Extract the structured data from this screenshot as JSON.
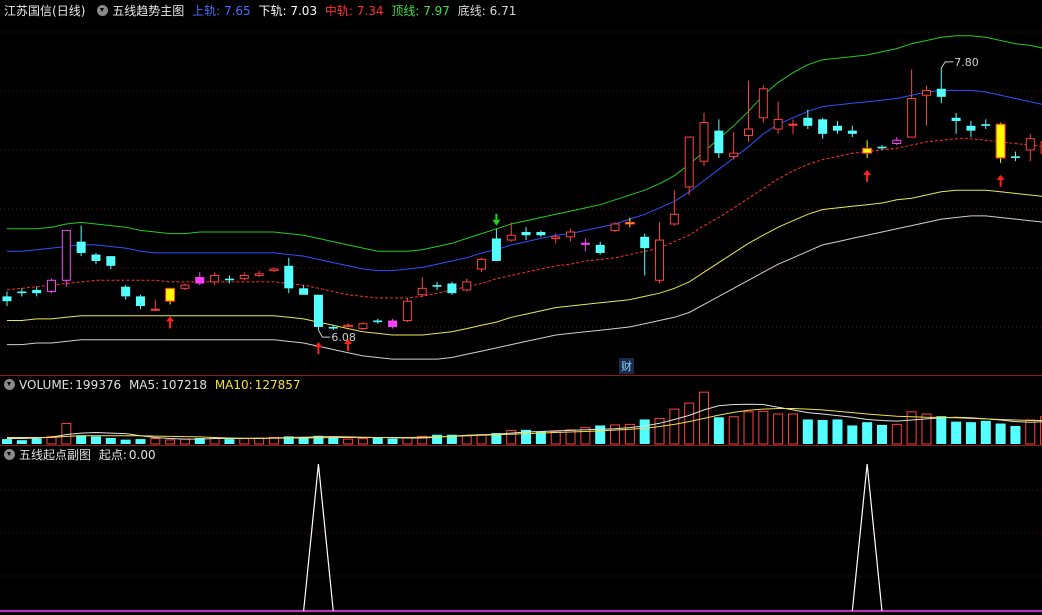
{
  "main": {
    "stock_name": "江苏国信",
    "period": "(日线)",
    "indicator": "五线趋势主图",
    "values": [
      {
        "label": "上轨:",
        "value": "7.65",
        "color": "#4a6dff"
      },
      {
        "label": "下轨:",
        "value": "7.03",
        "color": "#ffffff"
      },
      {
        "label": "中轨:",
        "value": "7.34",
        "color": "#ff3030"
      },
      {
        "label": "顶线:",
        "value": "7.97",
        "color": "#40e040"
      },
      {
        "label": "底线:",
        "value": "6.71",
        "color": "#d8d8d8"
      }
    ],
    "low_label": "6.08",
    "high_label": "7.80",
    "cai_label": "财"
  },
  "volume": {
    "label": "VOLUME:",
    "value": "199376",
    "ma5_label": "MA5:",
    "ma5_value": "107218",
    "ma10_label": "MA10:",
    "ma10_value": "127857"
  },
  "sub": {
    "indicator": "五线起点副图",
    "label": "起点:",
    "value": "0.00"
  },
  "chart_data": {
    "type": "candlestick",
    "candles": [
      [
        6.52,
        6.49,
        6.55,
        6.46
      ],
      [
        6.55,
        6.54,
        6.57,
        6.52
      ],
      [
        6.56,
        6.54,
        6.58,
        6.52
      ],
      [
        6.55,
        6.62,
        6.63,
        6.54
      ],
      [
        6.62,
        6.93,
        6.93,
        6.58
      ],
      [
        6.86,
        6.79,
        6.96,
        6.77
      ],
      [
        6.78,
        6.74,
        6.79,
        6.72
      ],
      [
        6.77,
        6.71,
        6.77,
        6.69
      ],
      [
        6.58,
        6.52,
        6.59,
        6.5
      ],
      [
        6.52,
        6.46,
        6.53,
        6.44
      ],
      [
        6.44,
        6.44,
        6.5,
        6.43
      ],
      [
        6.49,
        6.57,
        6.57,
        6.47
      ],
      [
        6.57,
        6.59,
        6.6,
        6.56
      ],
      [
        6.64,
        6.6,
        6.67,
        6.59
      ],
      [
        6.61,
        6.65,
        6.67,
        6.59
      ],
      [
        6.63,
        6.62,
        6.65,
        6.6
      ],
      [
        6.63,
        6.65,
        6.67,
        6.62
      ],
      [
        6.65,
        6.66,
        6.68,
        6.64
      ],
      [
        6.68,
        6.69,
        6.7,
        6.67
      ],
      [
        6.71,
        6.57,
        6.76,
        6.54
      ],
      [
        6.57,
        6.53,
        6.59,
        6.53
      ],
      [
        6.53,
        6.33,
        6.53,
        6.31
      ],
      [
        6.33,
        6.32,
        6.34,
        6.31
      ],
      [
        6.34,
        6.34,
        6.35,
        6.33
      ],
      [
        6.32,
        6.35,
        6.36,
        6.31
      ],
      [
        6.37,
        6.36,
        6.38,
        6.35
      ],
      [
        6.37,
        6.33,
        6.38,
        6.32
      ],
      [
        6.37,
        6.49,
        6.51,
        6.36
      ],
      [
        6.53,
        6.57,
        6.64,
        6.52
      ],
      [
        6.59,
        6.58,
        6.61,
        6.56
      ],
      [
        6.6,
        6.54,
        6.61,
        6.53
      ],
      [
        6.56,
        6.61,
        6.63,
        6.55
      ],
      [
        6.69,
        6.75,
        6.76,
        6.67
      ],
      [
        6.88,
        6.74,
        6.94,
        6.74
      ],
      [
        6.87,
        6.9,
        6.98,
        6.86
      ],
      [
        6.92,
        6.9,
        6.95,
        6.87
      ],
      [
        6.92,
        6.9,
        6.93,
        6.89
      ],
      [
        6.88,
        6.89,
        6.91,
        6.85
      ],
      [
        6.89,
        6.92,
        6.94,
        6.86
      ],
      [
        6.85,
        6.85,
        6.88,
        6.8
      ],
      [
        6.84,
        6.79,
        6.86,
        6.78
      ],
      [
        6.93,
        6.97,
        6.98,
        6.92
      ],
      [
        6.97,
        6.98,
        7.01,
        6.95
      ],
      [
        6.89,
        6.82,
        6.91,
        6.65
      ],
      [
        6.62,
        6.87,
        6.98,
        6.6
      ],
      [
        6.97,
        7.03,
        7.18,
        6.96
      ],
      [
        7.2,
        7.51,
        7.51,
        7.15
      ],
      [
        7.36,
        7.6,
        7.66,
        7.33
      ],
      [
        7.55,
        7.41,
        7.62,
        7.38
      ],
      [
        7.39,
        7.41,
        7.54,
        7.37
      ],
      [
        7.52,
        7.56,
        7.86,
        7.48
      ],
      [
        7.63,
        7.81,
        7.83,
        7.6
      ],
      [
        7.56,
        7.62,
        7.73,
        7.53
      ],
      [
        7.59,
        7.59,
        7.62,
        7.53
      ],
      [
        7.63,
        7.58,
        7.68,
        7.56
      ],
      [
        7.62,
        7.53,
        7.63,
        7.5
      ],
      [
        7.58,
        7.55,
        7.61,
        7.53
      ],
      [
        7.55,
        7.53,
        7.58,
        7.51
      ],
      [
        7.44,
        7.41,
        7.49,
        7.38
      ],
      [
        7.45,
        7.44,
        7.46,
        7.43
      ],
      [
        7.47,
        7.49,
        7.51,
        7.46
      ],
      [
        7.51,
        7.75,
        7.93,
        7.51
      ],
      [
        7.77,
        7.8,
        7.83,
        7.58
      ],
      [
        7.81,
        7.76,
        7.94,
        7.72
      ],
      [
        7.63,
        7.61,
        7.66,
        7.53
      ],
      [
        7.58,
        7.55,
        7.61,
        7.51
      ],
      [
        7.59,
        7.58,
        7.62,
        7.56
      ],
      [
        7.59,
        7.38,
        7.6,
        7.35
      ],
      [
        7.39,
        7.38,
        7.42,
        7.36
      ],
      [
        7.43,
        7.5,
        7.53,
        7.36
      ],
      [
        7.41,
        7.48,
        7.56,
        7.4
      ]
    ],
    "bands": {
      "top": [
        6.94,
        6.94,
        6.94,
        6.95,
        6.97,
        6.98,
        6.97,
        6.96,
        6.95,
        6.93,
        6.92,
        6.91,
        6.91,
        6.92,
        6.92,
        6.92,
        6.92,
        6.92,
        6.92,
        6.91,
        6.9,
        6.88,
        6.86,
        6.84,
        6.82,
        6.8,
        6.8,
        6.8,
        6.81,
        6.83,
        6.85,
        6.88,
        6.91,
        6.94,
        6.97,
        6.99,
        7.01,
        7.03,
        7.05,
        7.07,
        7.09,
        7.12,
        7.15,
        7.18,
        7.22,
        7.27,
        7.34,
        7.42,
        7.5,
        7.58,
        7.67,
        7.77,
        7.85,
        7.91,
        7.96,
        7.99,
        8.0,
        8.01,
        8.02,
        8.04,
        8.06,
        8.09,
        8.11,
        8.13,
        8.14,
        8.14,
        8.13,
        8.11,
        8.09,
        8.08,
        8.06
      ],
      "upper": [
        6.8,
        6.8,
        6.81,
        6.82,
        6.83,
        6.84,
        6.84,
        6.83,
        6.82,
        6.8,
        6.79,
        6.79,
        6.79,
        6.79,
        6.79,
        6.79,
        6.79,
        6.79,
        6.79,
        6.78,
        6.77,
        6.75,
        6.73,
        6.71,
        6.69,
        6.68,
        6.68,
        6.69,
        6.7,
        6.72,
        6.74,
        6.76,
        6.79,
        6.81,
        6.84,
        6.86,
        6.88,
        6.9,
        6.91,
        6.93,
        6.95,
        6.97,
        7.0,
        7.03,
        7.07,
        7.11,
        7.17,
        7.24,
        7.31,
        7.38,
        7.45,
        7.53,
        7.59,
        7.63,
        7.67,
        7.7,
        7.71,
        7.72,
        7.73,
        7.74,
        7.75,
        7.77,
        7.79,
        7.8,
        7.8,
        7.8,
        7.79,
        7.77,
        7.75,
        7.73,
        7.71
      ],
      "mid": [
        6.56,
        6.57,
        6.58,
        6.59,
        6.6,
        6.61,
        6.62,
        6.62,
        6.62,
        6.62,
        6.62,
        6.61,
        6.61,
        6.61,
        6.61,
        6.61,
        6.61,
        6.61,
        6.61,
        6.6,
        6.59,
        6.57,
        6.55,
        6.53,
        6.52,
        6.51,
        6.51,
        6.51,
        6.52,
        6.54,
        6.56,
        6.58,
        6.6,
        6.63,
        6.65,
        6.67,
        6.69,
        6.71,
        6.72,
        6.74,
        6.75,
        6.76,
        6.78,
        6.8,
        6.82,
        6.86,
        6.9,
        6.96,
        7.01,
        7.07,
        7.13,
        7.19,
        7.25,
        7.3,
        7.34,
        7.37,
        7.39,
        7.41,
        7.42,
        7.43,
        7.44,
        7.46,
        7.48,
        7.49,
        7.5,
        7.5,
        7.49,
        7.48,
        7.47,
        7.46,
        7.45
      ],
      "lower": [
        6.37,
        6.37,
        6.38,
        6.38,
        6.39,
        6.4,
        6.4,
        6.4,
        6.4,
        6.4,
        6.4,
        6.4,
        6.4,
        6.4,
        6.4,
        6.4,
        6.4,
        6.4,
        6.4,
        6.39,
        6.38,
        6.36,
        6.34,
        6.32,
        6.3,
        6.29,
        6.28,
        6.28,
        6.28,
        6.29,
        6.3,
        6.32,
        6.34,
        6.36,
        6.39,
        6.41,
        6.43,
        6.45,
        6.46,
        6.47,
        6.48,
        6.49,
        6.5,
        6.52,
        6.54,
        6.57,
        6.61,
        6.67,
        6.73,
        6.79,
        6.85,
        6.9,
        6.95,
        6.99,
        7.03,
        7.06,
        7.07,
        7.08,
        7.09,
        7.1,
        7.12,
        7.13,
        7.15,
        7.17,
        7.18,
        7.18,
        7.18,
        7.17,
        7.16,
        7.15,
        7.14
      ],
      "bottom": [
        6.22,
        6.22,
        6.23,
        6.23,
        6.24,
        6.25,
        6.25,
        6.25,
        6.25,
        6.25,
        6.25,
        6.25,
        6.25,
        6.25,
        6.25,
        6.25,
        6.25,
        6.25,
        6.25,
        6.24,
        6.23,
        6.21,
        6.19,
        6.17,
        6.15,
        6.14,
        6.13,
        6.13,
        6.13,
        6.13,
        6.14,
        6.16,
        6.18,
        6.2,
        6.22,
        6.24,
        6.26,
        6.28,
        6.29,
        6.3,
        6.31,
        6.32,
        6.33,
        6.35,
        6.37,
        6.39,
        6.42,
        6.47,
        6.52,
        6.57,
        6.62,
        6.67,
        6.72,
        6.76,
        6.8,
        6.84,
        6.86,
        6.88,
        6.9,
        6.92,
        6.94,
        6.96,
        6.98,
        7.0,
        7.01,
        7.02,
        7.02,
        7.01,
        7.0,
        6.99,
        6.98
      ]
    },
    "up_arrows": [
      11,
      21,
      23,
      58,
      67
    ],
    "down_arrows": [
      33
    ],
    "highlight_bars": [
      11,
      23,
      42,
      58,
      67
    ],
    "magenta_bars": [
      3,
      4,
      13,
      26,
      39,
      60
    ],
    "volume": [
      18,
      14,
      20,
      28,
      75,
      32,
      28,
      22,
      16,
      18,
      20,
      15,
      18,
      22,
      20,
      18,
      20,
      22,
      24,
      28,
      26,
      30,
      24,
      18,
      20,
      22,
      20,
      22,
      28,
      34,
      34,
      30,
      34,
      40,
      50,
      52,
      46,
      44,
      52,
      60,
      68,
      70,
      72,
      90,
      94,
      128,
      150,
      190,
      98,
      100,
      118,
      120,
      110,
      110,
      90,
      88,
      90,
      68,
      80,
      70,
      72,
      118,
      110,
      102,
      82,
      80,
      85,
      75,
      66,
      88,
      100
    ],
    "ma5": [
      20,
      20,
      22,
      25,
      35,
      40,
      42,
      40,
      38,
      30,
      24,
      20,
      18,
      18,
      20,
      20,
      20,
      20,
      22,
      24,
      25,
      26,
      27,
      26,
      25,
      24,
      23,
      22,
      22,
      25,
      29,
      32,
      34,
      36,
      40,
      44,
      46,
      48,
      50,
      52,
      54,
      56,
      60,
      66,
      76,
      90,
      105,
      125,
      140,
      145,
      146,
      145,
      135,
      125,
      115,
      110,
      104,
      98,
      90,
      86,
      84,
      88,
      92,
      96,
      98,
      96,
      92,
      88,
      82,
      80,
      82
    ],
    "ma10": [
      24,
      24,
      24,
      24,
      28,
      30,
      30,
      30,
      30,
      30,
      29,
      28,
      27,
      26,
      24,
      22,
      21,
      21,
      21,
      22,
      22,
      23,
      24,
      24,
      24,
      24,
      24,
      24,
      25,
      26,
      28,
      30,
      32,
      34,
      36,
      38,
      40,
      42,
      44,
      46,
      48,
      51,
      54,
      58,
      64,
      72,
      82,
      94,
      106,
      116,
      124,
      128,
      130,
      130,
      128,
      125,
      120,
      115,
      110,
      106,
      102,
      100,
      98,
      97,
      96,
      94,
      92,
      90,
      88,
      86,
      86
    ],
    "sub_peaks": [
      21,
      58
    ],
    "ylim": [
      6.05,
      8.25
    ],
    "volume_ylim": [
      0,
      220
    ],
    "sub_ylim": [
      0,
      1
    ]
  }
}
